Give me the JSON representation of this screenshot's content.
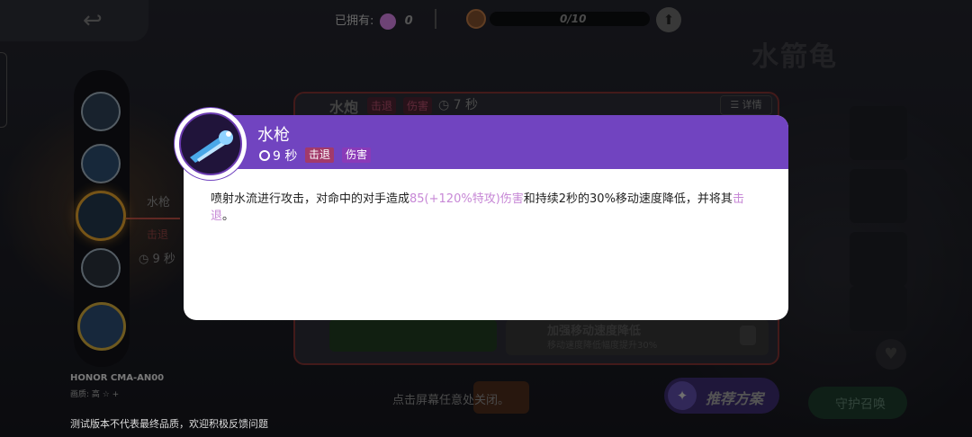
{
  "topbar": {
    "owned_label": "已拥有:",
    "owned_count": "0",
    "progress_text": "0/10"
  },
  "hero": {
    "name_bg": "水箭龟"
  },
  "bg_skill": {
    "name": "水枪",
    "tag": "击退",
    "cooldown": "9 秒"
  },
  "bg_panel": {
    "skill_name": "水炮",
    "tag1": "击退",
    "tag2": "伤害",
    "cooldown": "7 秒",
    "detail_label": "详情",
    "card_title": "加强移动速度降低",
    "card_desc": "移动速度降低幅度提升30%"
  },
  "device": {
    "name": "HONOR CMA-AN00",
    "quality": "画质: 高 ☆ +"
  },
  "disclaimer": "测试版本不代表最终品质，欢迎积极反馈问题",
  "close_hint": "点击屏幕任意处关闭。",
  "recommend_label": "推荐方案",
  "equip_label": "守护召唤",
  "modal": {
    "title": "水枪",
    "cooldown": "9 秒",
    "tag_knockback": "击退",
    "tag_damage": "伤害",
    "desc_part1": "喷射水流进行攻击，对命中的对手造成",
    "desc_highlight1": "85(+120%特攻)伤害",
    "desc_part2": "和持续2秒的30%移动速度降低，并将其",
    "desc_highlight2": "击退",
    "desc_part3": "。"
  },
  "colors": {
    "modal_header": "#7144c0",
    "highlight": "#c788d6",
    "tag_knockback": "#a23a6a",
    "tag_damage": "#8a3ab8"
  }
}
